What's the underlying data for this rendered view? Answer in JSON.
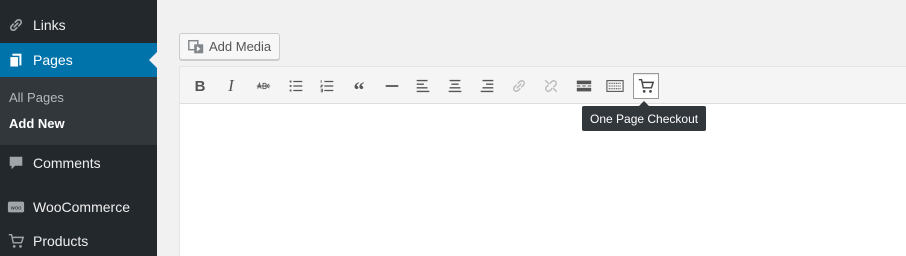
{
  "sidebar": {
    "links_label": "Links",
    "pages_label": "Pages",
    "submenu": {
      "all_pages": "All Pages",
      "add_new": "Add New"
    },
    "comments_label": "Comments",
    "woocommerce_label": "WooCommerce",
    "products_label": "Products"
  },
  "editor": {
    "add_media_label": "Add Media",
    "toolbar_icons": [
      "bold",
      "italic",
      "strikethrough",
      "bullet-list",
      "numbered-list",
      "blockquote",
      "horizontal-line",
      "align-left",
      "align-center",
      "align-right",
      "insert-link",
      "remove-link",
      "read-more",
      "toolbar-toggle",
      "cart"
    ],
    "bold_glyph": "B",
    "italic_glyph": "I",
    "quote_glyph": "“",
    "tooltip": "One Page Checkout"
  },
  "colors": {
    "sidebar_bg": "#23282d",
    "active_menu": "#0073aa",
    "submenu_bg": "#32373c"
  }
}
